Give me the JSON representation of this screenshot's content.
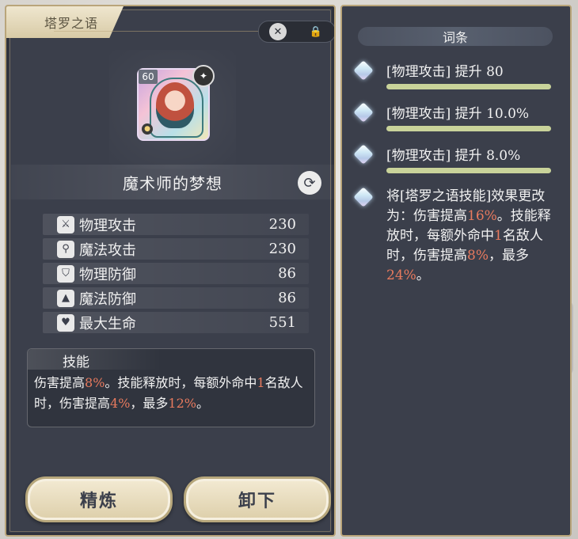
{
  "equipment_panel": {
    "title": "塔罗之语",
    "level_badge": "60",
    "card_name": "魔术师的梦想",
    "stats": [
      {
        "icon": "sword-icon",
        "label": "物理攻击",
        "value": "230"
      },
      {
        "icon": "wand-icon",
        "label": "魔法攻击",
        "value": "230"
      },
      {
        "icon": "shield-icon",
        "label": "物理防御",
        "value": "86"
      },
      {
        "icon": "witch-hat-icon",
        "label": "魔法防御",
        "value": "86"
      },
      {
        "icon": "heart-icon",
        "label": "最大生命",
        "value": "551"
      }
    ],
    "skill": {
      "title": "技能",
      "desc_parts": [
        {
          "text": "伤害提高",
          "hl": false
        },
        {
          "text": "8%",
          "hl": true
        },
        {
          "text": "。技能释放时，每额外命中",
          "hl": false
        },
        {
          "text": "1",
          "hl": true
        },
        {
          "text": "名敌人时，伤害提高",
          "hl": false
        },
        {
          "text": "4%",
          "hl": true
        },
        {
          "text": "，最多",
          "hl": false
        },
        {
          "text": "12%",
          "hl": true
        },
        {
          "text": "。",
          "hl": false
        }
      ]
    },
    "buttons": {
      "refine": "精炼",
      "unequip": "卸下"
    }
  },
  "affix_panel": {
    "header": "词条",
    "affixes": [
      {
        "text": "[物理攻击] 提升 80"
      },
      {
        "text": "[物理攻击] 提升 10.0%"
      },
      {
        "text": "[物理攻击] 提升 8.0%"
      }
    ],
    "special_parts": [
      {
        "text": "将[塔罗之语技能]效果更改为：伤害提高",
        "hl": false
      },
      {
        "text": "16%",
        "hl": true
      },
      {
        "text": "。技能释放时，每额外命中",
        "hl": false
      },
      {
        "text": "1",
        "hl": true
      },
      {
        "text": "名敌人时，伤害提高",
        "hl": false
      },
      {
        "text": "8%",
        "hl": true
      },
      {
        "text": "，最多",
        "hl": false
      },
      {
        "text": "24%",
        "hl": true
      },
      {
        "text": "。",
        "hl": false
      }
    ]
  },
  "colors": {
    "highlight": "#e87a5e",
    "panel_bg": "#3b3f4b",
    "gold_border": "#b9a57a",
    "affix_bar": "#c9d39a"
  }
}
